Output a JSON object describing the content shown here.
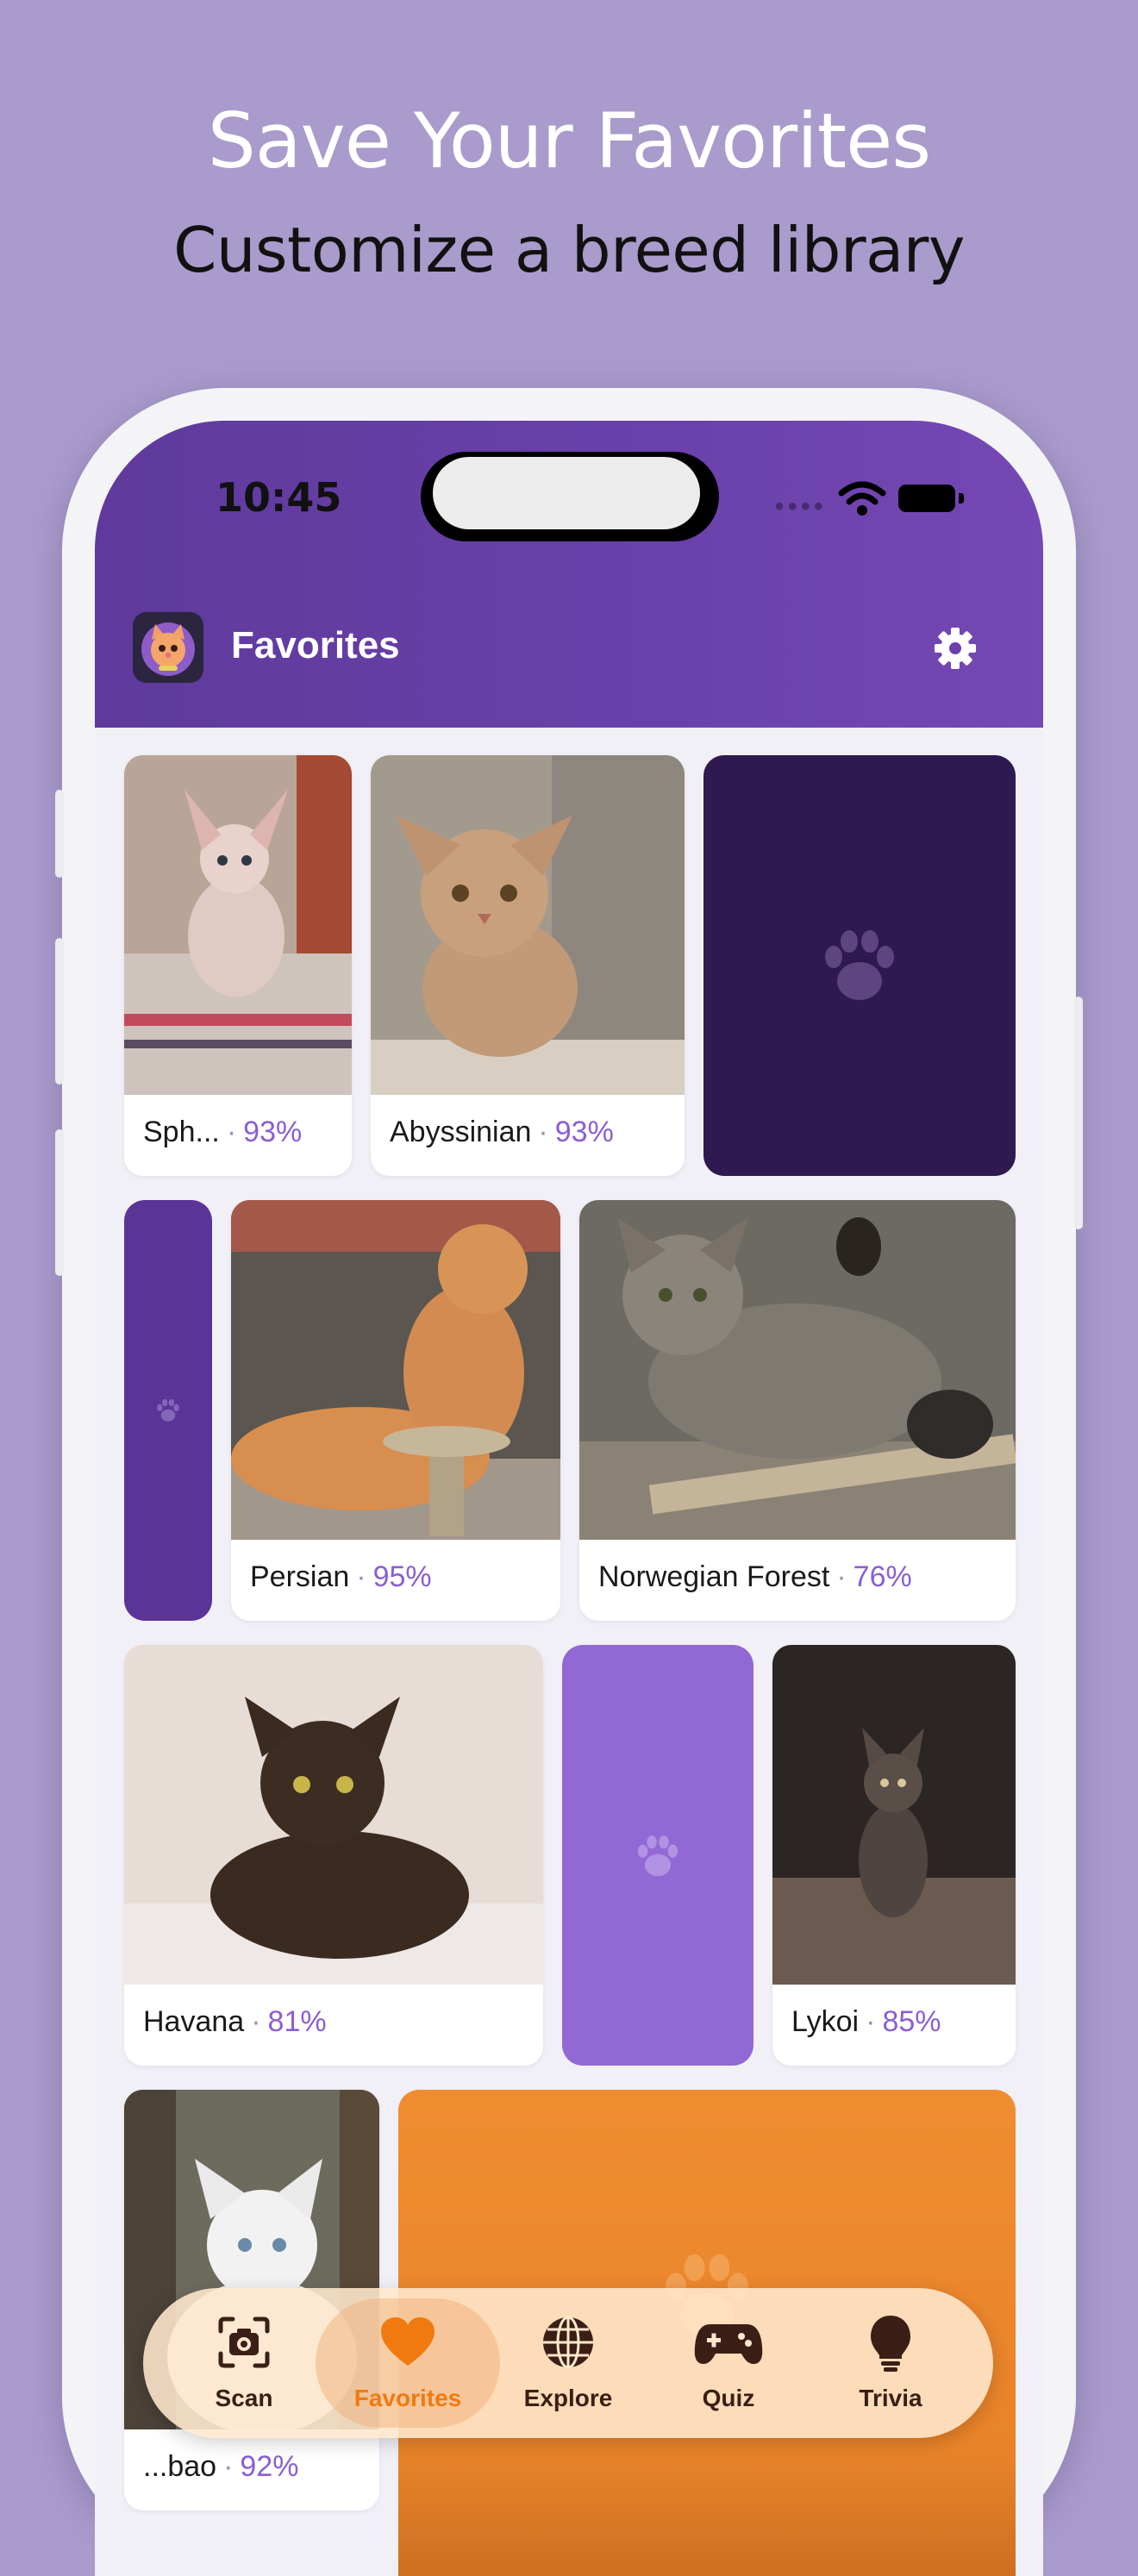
{
  "promo": {
    "title": "Save Your Favorites",
    "subtitle": "Customize a breed library"
  },
  "status_bar": {
    "time": "10:45"
  },
  "header": {
    "title": "Favorites",
    "settings_icon": "gear-icon"
  },
  "favorites": [
    {
      "name": "Sph...",
      "percent": "93%"
    },
    {
      "name": "Abyssinian",
      "percent": "93%"
    },
    {
      "name": "Persian",
      "percent": "95%"
    },
    {
      "name": "Norwegian Forest",
      "percent": "76%"
    },
    {
      "name": "Havana",
      "percent": "81%"
    },
    {
      "name": "Lykoi",
      "percent": "85%"
    },
    {
      "name": "...bao",
      "percent": "92%"
    }
  ],
  "separator": "·",
  "tabs": [
    {
      "label": "Scan",
      "icon": "camera-icon"
    },
    {
      "label": "Favorites",
      "icon": "heart-icon",
      "active": true
    },
    {
      "label": "Explore",
      "icon": "globe-icon"
    },
    {
      "label": "Quiz",
      "icon": "gamepad-icon"
    },
    {
      "label": "Trivia",
      "icon": "lightbulb-icon"
    }
  ],
  "colors": {
    "background": "#a99bcb",
    "header": "#6a41ab",
    "accent_percent": "#8b5ed4",
    "active_tab": "#f07a10",
    "placeholder_dark": "#2e1a50",
    "placeholder_mid": "#5b3498",
    "placeholder_light": "#9268d4",
    "placeholder_orange": "#f08c30"
  }
}
